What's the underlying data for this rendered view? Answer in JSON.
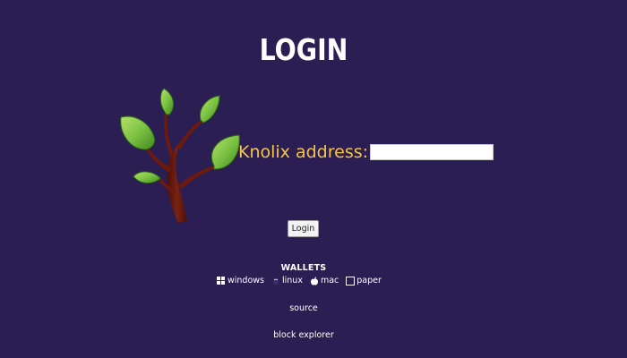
{
  "page": {
    "title": "LOGIN"
  },
  "form": {
    "address_label": "Knolix address:",
    "address_value": "",
    "login_button": "Login"
  },
  "wallets": {
    "heading": "WALLETS",
    "items": [
      {
        "label": "windows",
        "icon": "windows-icon"
      },
      {
        "label": "linux",
        "icon": "linux-icon"
      },
      {
        "label": "mac",
        "icon": "apple-icon"
      },
      {
        "label": "paper",
        "icon": "paper-icon"
      }
    ]
  },
  "links": {
    "source": "source",
    "block_explorer": "block explorer"
  },
  "colors": {
    "background": "#2b1e52",
    "accent": "#f5c445",
    "leaf": "#7cc243",
    "trunk": "#6b1a10"
  }
}
